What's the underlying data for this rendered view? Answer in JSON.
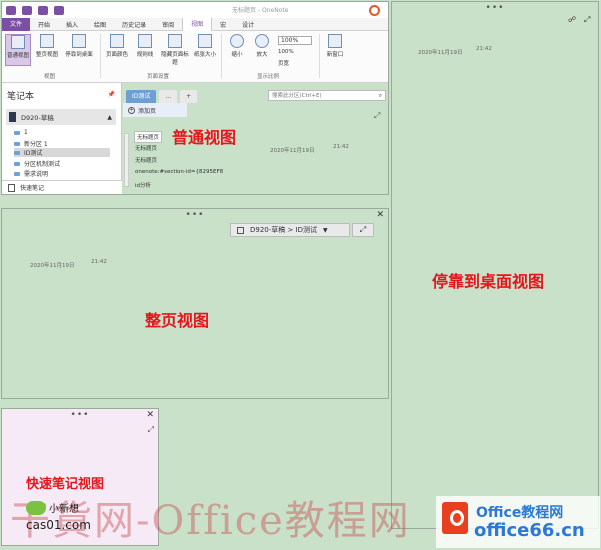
{
  "normal_view": {
    "window_title": "无标题页 - OneNote",
    "tabs": [
      "文件",
      "开始",
      "插入",
      "绘图",
      "历史记录",
      "审阅",
      "视图",
      "宏",
      "设计"
    ],
    "ribbon": {
      "buttons": [
        "普通视图",
        "整页视图",
        "停靠到桌面",
        "页面颜色",
        "规则线",
        "隐藏页面标题",
        "纸张大小",
        "缩小",
        "放大",
        "新窗口"
      ],
      "zoom_value": "100%",
      "zoom_options": [
        "100%",
        "页宽"
      ],
      "groups": [
        "视图",
        "页面设置",
        "显示比例"
      ]
    },
    "notebook_header": "笔记本",
    "notebook_name": "D920-草稿",
    "sections": [
      "1",
      "新分区 1",
      "ID测试",
      "分区机制测试",
      "需求说明"
    ],
    "quick_notes": "快速笔记",
    "section_tabs": [
      "ID测试",
      "...",
      "+"
    ],
    "search_placeholder": "搜索此分区(Ctrl+E)",
    "add_page": "添加页",
    "pages": [
      "无标题页",
      "无标题页",
      "无标题页",
      "onenote:#section-id={8295EF8",
      "id分析"
    ],
    "date": "2020年11月19日",
    "time": "21:42",
    "label": "普通视图"
  },
  "full_page": {
    "breadcrumb": "D920-草稿 > ID测试",
    "date": "2020年11月19日",
    "time": "21:42",
    "label": "整页视图"
  },
  "dock": {
    "date": "2020年11月19日",
    "time": "21:42",
    "label": "停靠到桌面视图"
  },
  "quick_note": {
    "label": "快速笔记视图"
  },
  "watermark": {
    "main": "干貨网-Office教程网",
    "chat": "小新想",
    "site": "cas01.com",
    "brand_line1": "Office教程网",
    "brand_line2": "office66.cn"
  },
  "colors": {
    "accent": "#7b4fa3",
    "canvas": "#c9e0c9",
    "label": "#e5151b"
  }
}
